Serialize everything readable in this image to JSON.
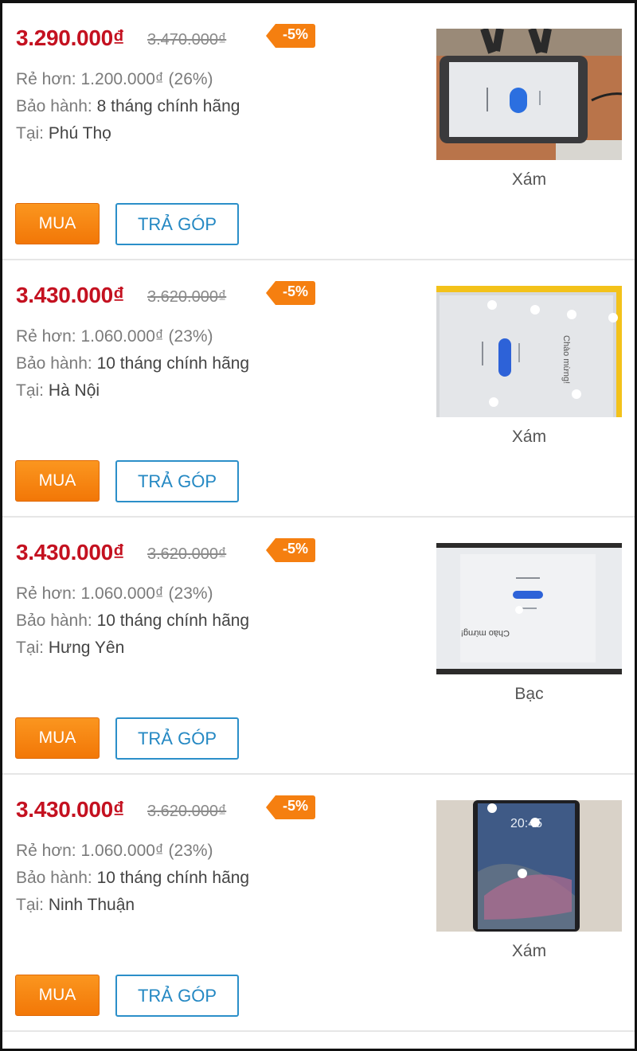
{
  "listings": [
    {
      "price": "3.290.000₫",
      "old_price": "3.470.000₫",
      "discount": "-5%",
      "cheaper_label": "Rẻ hơn:",
      "cheaper_value": "1.200.000₫ (26%)",
      "warranty_label": "Bảo hành:",
      "warranty_value": "8 tháng chính hãng",
      "location_label": "Tại:",
      "location_value": "Phú Thọ",
      "color": "Xám",
      "buy_label": "MUA",
      "installment_label": "TRẢ GÓP"
    },
    {
      "price": "3.430.000₫",
      "old_price": "3.620.000₫",
      "discount": "-5%",
      "cheaper_label": "Rẻ hơn:",
      "cheaper_value": "1.060.000₫ (23%)",
      "warranty_label": "Bảo hành:",
      "warranty_value": "10 tháng chính hãng",
      "location_label": "Tại:",
      "location_value": "Hà Nội",
      "color": "Xám",
      "buy_label": "MUA",
      "installment_label": "TRẢ GÓP"
    },
    {
      "price": "3.430.000₫",
      "old_price": "3.620.000₫",
      "discount": "-5%",
      "cheaper_label": "Rẻ hơn:",
      "cheaper_value": "1.060.000₫ (23%)",
      "warranty_label": "Bảo hành:",
      "warranty_value": "10 tháng chính hãng",
      "location_label": "Tại:",
      "location_value": "Hưng Yên",
      "color": "Bạc",
      "buy_label": "MUA",
      "installment_label": "TRẢ GÓP"
    },
    {
      "price": "3.430.000₫",
      "old_price": "3.620.000₫",
      "discount": "-5%",
      "cheaper_label": "Rẻ hơn:",
      "cheaper_value": "1.060.000₫ (23%)",
      "warranty_label": "Bảo hành:",
      "warranty_value": "10 tháng chính hãng",
      "location_label": "Tại:",
      "location_value": "Ninh Thuận",
      "color": "Xám",
      "buy_label": "MUA",
      "installment_label": "TRẢ GÓP"
    }
  ],
  "thumb_text": {
    "greeting": "Chào mừng!",
    "lock_time": "20:45"
  },
  "colors": {
    "price_red": "#c41120",
    "buy_orange": "#f58a13",
    "install_blue": "#2b8fc9",
    "badge_orange": "#f57f10"
  }
}
